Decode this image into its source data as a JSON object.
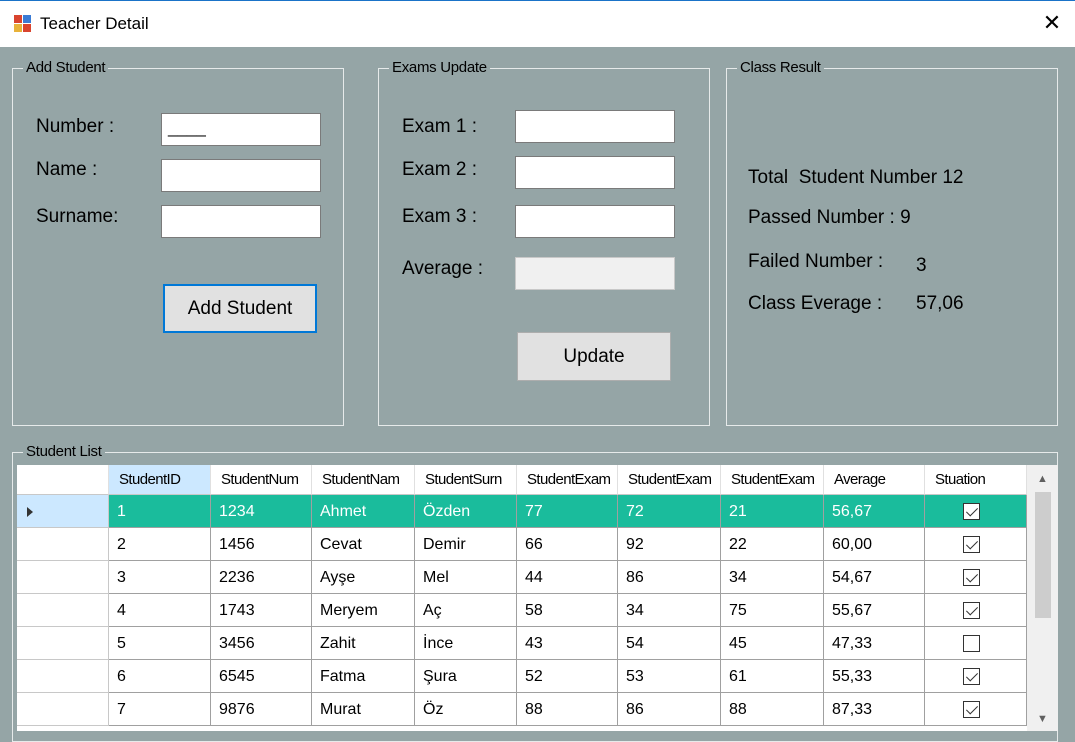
{
  "window": {
    "title": "Teacher Detail",
    "close_glyph": "✕"
  },
  "add_student": {
    "legend": "Add Student",
    "number_label": "Number :",
    "number_mask": "____",
    "name_label": "Name :",
    "surname_label": "Surname:",
    "button": "Add Student"
  },
  "exams_update": {
    "legend": "Exams Update",
    "exam1_label": "Exam 1 :",
    "exam2_label": "Exam 2 :",
    "exam3_label": "Exam 3 :",
    "average_label": "Average :",
    "button": "Update"
  },
  "class_result": {
    "legend": "Class Result",
    "total_label": "Total  Student Number 12",
    "passed_label": "Passed Number : 9",
    "failed_label": "Failed Number :",
    "failed_value": "3",
    "average_label": "Class Everage :",
    "average_value": "57,06"
  },
  "student_list": {
    "legend": "Student List",
    "columns": [
      "StudentID",
      "StudentNum",
      "StudentNam",
      "StudentSurn",
      "StudentExam",
      "StudentExam",
      "StudentExam",
      "Average",
      "Stuation"
    ],
    "rows": [
      [
        "1",
        "1234",
        "Ahmet",
        "Özden",
        "77",
        "72",
        "21",
        "56,67",
        true
      ],
      [
        "2",
        "1456",
        "Cevat",
        "Demir",
        "66",
        "92",
        "22",
        "60,00",
        true
      ],
      [
        "3",
        "2236",
        "Ayşe",
        "Mel",
        "44",
        "86",
        "34",
        "54,67",
        true
      ],
      [
        "4",
        "1743",
        "Meryem",
        "Aç",
        "58",
        "34",
        "75",
        "55,67",
        true
      ],
      [
        "5",
        "3456",
        "Zahit",
        "İnce",
        "43",
        "54",
        "45",
        "47,33",
        false
      ],
      [
        "6",
        "6545",
        "Fatma",
        "Şura",
        "52",
        "53",
        "61",
        "55,33",
        true
      ],
      [
        "7",
        "9876",
        "Murat",
        "Öz",
        "88",
        "86",
        "88",
        "87,33",
        true
      ]
    ],
    "selected_row": 0,
    "selected_color": "#1abc9c"
  },
  "colors": {
    "form_background": "#95a5a6",
    "accent": "#0078d7"
  }
}
